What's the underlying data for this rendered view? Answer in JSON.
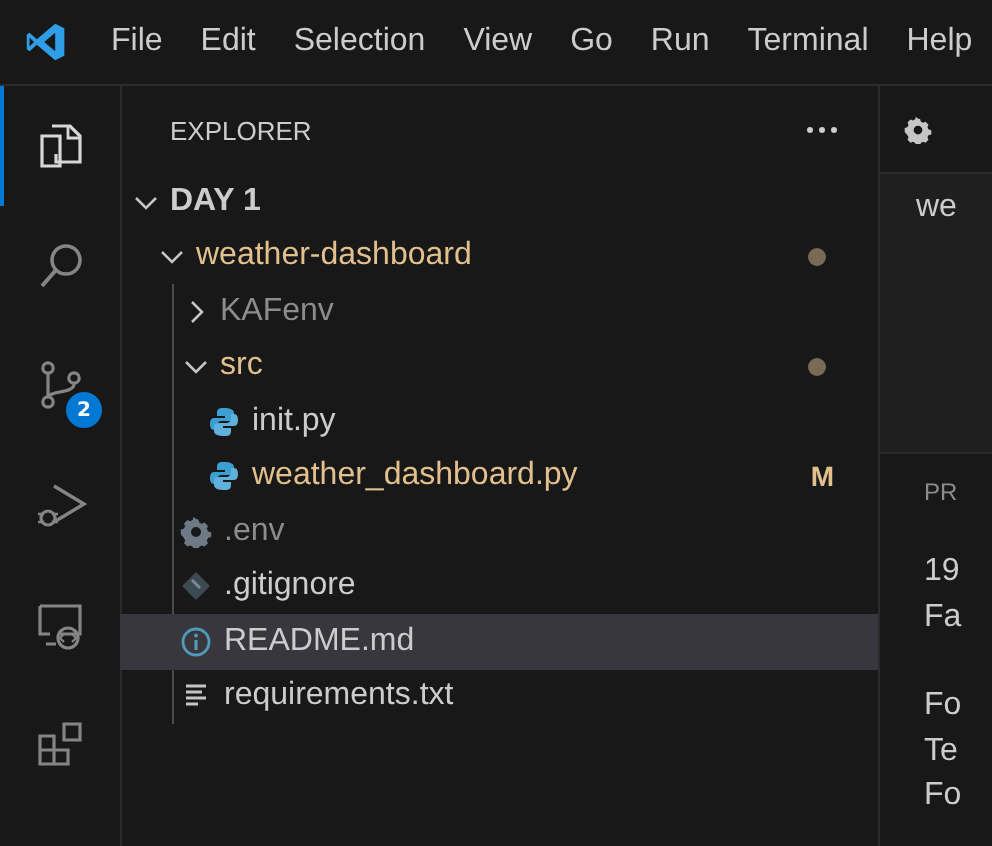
{
  "menu": [
    {
      "label": "File"
    },
    {
      "label": "Edit"
    },
    {
      "label": "Selection"
    },
    {
      "label": "View"
    },
    {
      "label": "Go"
    },
    {
      "label": "Run"
    },
    {
      "label": "Terminal"
    },
    {
      "label": "Help"
    }
  ],
  "activity_bar": [
    {
      "kind": "explorer",
      "selected": true
    },
    {
      "kind": "search",
      "selected": false
    },
    {
      "kind": "source-control",
      "selected": false,
      "badge": "2"
    },
    {
      "kind": "run-debug",
      "selected": false
    },
    {
      "kind": "remote",
      "selected": false
    },
    {
      "kind": "extensions",
      "selected": false
    }
  ],
  "explorer": {
    "title": "EXPLORER",
    "tree": [
      {
        "label": "DAY 1",
        "kind": "root",
        "expanded": true,
        "children": [
          {
            "label": "weather-dashboard",
            "kind": "folder",
            "color": "#e2c08d",
            "expanded": true,
            "dot": true,
            "children": [
              {
                "label": "KAFenv",
                "kind": "folder",
                "color": "#8c8c8c",
                "expanded": false,
                "dot": false
              },
              {
                "label": "src",
                "kind": "folder",
                "color": "#e2c08d",
                "expanded": true,
                "dot": true,
                "children": [
                  {
                    "label": "init.py",
                    "kind": "python",
                    "color": "#cccccc",
                    "selected": false
                  },
                  {
                    "label": "weather_dashboard.py",
                    "kind": "python",
                    "color": "#e2c08d",
                    "badge": "M",
                    "selected": false
                  }
                ]
              },
              {
                "label": ".env",
                "kind": "settings",
                "color": "#8c8c8c",
                "selected": false
              },
              {
                "label": ".gitignore",
                "kind": "git",
                "color": "#cccccc",
                "selected": false
              },
              {
                "label": "README.md",
                "kind": "info",
                "color": "#cccccc",
                "selected": true
              },
              {
                "label": "requirements.txt",
                "kind": "text",
                "color": "#cccccc",
                "selected": false
              }
            ]
          }
        ]
      }
    ]
  },
  "editor": {
    "tab_label": "we",
    "panel_heading": "PR",
    "paragraphs": [
      [
        "19",
        "Fa"
      ],
      [
        "Fo",
        "Te",
        "Fo"
      ]
    ]
  }
}
